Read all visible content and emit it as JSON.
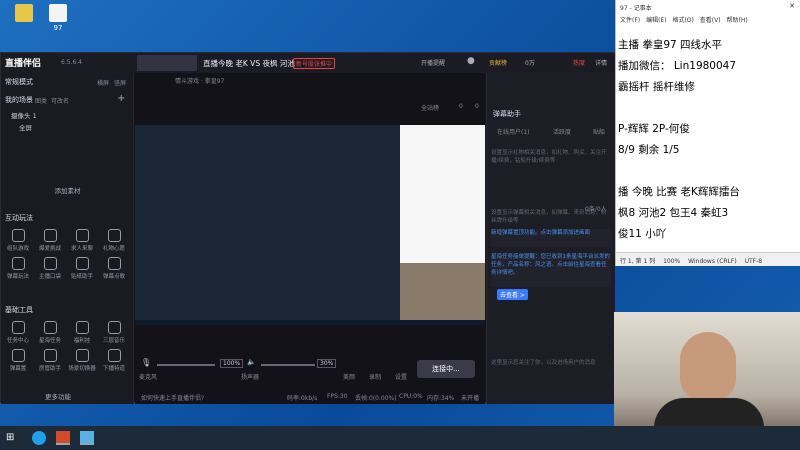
{
  "desktop": {
    "icons": [
      {
        "label": ""
      },
      {
        "label": "97"
      }
    ]
  },
  "app": {
    "title": "直播伴侣",
    "version": "6.5.6.4",
    "live_title": "直播今晚 老K VS 夜枫 河池",
    "live_tag": "新号股张推中",
    "category": "情斗游戏 · 拳皇97",
    "top_actions": [
      "开播提醒",
      "全站榜"
    ],
    "counters": {
      "likes": "0",
      "views": "0"
    },
    "mode": "常规模式",
    "mode_right": [
      "横屏",
      "竖屏"
    ],
    "scene_header": "我的场景",
    "scene_tabs": [
      "图类",
      "可改名"
    ],
    "sources": [
      "摄像头 1",
      "全屏"
    ],
    "add_material": "添加素材",
    "interact_header": "互动玩法",
    "interact_tools": [
      "组队游戏",
      "爆爱挑战",
      "求人来聊",
      "礼物心愿",
      "弹幕玩法",
      "主播口袋",
      "贴纸助手",
      "弹幕点歌"
    ],
    "basic_header": "基础工具",
    "basic_tools": [
      "任务中心",
      "星海任务",
      "福利挂",
      "三层音乐",
      "弹幕置",
      "房管助手",
      "场景切换器",
      "下播特道"
    ],
    "more": "更多功能",
    "hint": "如何快速上手直播伴侣?",
    "controls": {
      "mic_label": "麦克风",
      "mic_value": "100%",
      "speaker_label": "扬声器",
      "speaker_value": "30%",
      "beauty": "美颜",
      "record": "录制",
      "settings": "设置",
      "live_button": "连接中..."
    },
    "stats": {
      "bitrate": "码率:0kb/s",
      "fps": "FPS:30",
      "drop": "丢帧:0(0.00%)",
      "cpu": "CPU:0%",
      "mem": "内存:34%",
      "state": "未开播"
    }
  },
  "right": {
    "tab_labels": [
      "贡献榜",
      "0万"
    ],
    "hot": "热度",
    "detail": "详情",
    "assistant_title": "弹幕助手",
    "tabs": [
      "在线用户(1)",
      "活跃度",
      "贴船"
    ],
    "placeholder1": "设置显示礼物相关消息，如礼物、购买、关注开播/续费，钻船升级/续费等",
    "placeholder2": "设置显示弹幕相关消息，如弹幕、来到消息，粉丝牌升级等",
    "counter": "0条/0人",
    "notice1": "新增弹幕置顶功能。点击弹幕添加进画面",
    "notice2": "星海任务接单提醒：您已收到1条星海平台派发的任务，产品名称：风之语。点击前往星海查看任务详情吧。",
    "notice_link": "去查看 >",
    "footer": "这里显示您关注了你，以及进场用户的消息"
  },
  "notepad": {
    "title": "97 - 记事本",
    "menu": [
      "文件(F)",
      "编辑(E)",
      "格式(O)",
      "查看(V)",
      "帮助(H)"
    ],
    "lines": [
      "主播 拳皇97 四线水平",
      "播加微信：  Lin1980047",
      "霸摇杆  摇杆维修",
      "",
      "P-辉辉         2P-何俊",
      "8/9    剩余      1/5",
      "",
      "播 今晚 比赛  老K辉辉擂台",
      "枫8 河池2 包王4 秦虹3",
      "俊11  小吖"
    ],
    "status": [
      "行 1, 第 1 列",
      "100%",
      "Windows (CRLF)",
      "UTF-8"
    ]
  },
  "colors": {
    "accent": "#e63b3b",
    "blue": "#3c7bff",
    "bg": "#15151c"
  }
}
